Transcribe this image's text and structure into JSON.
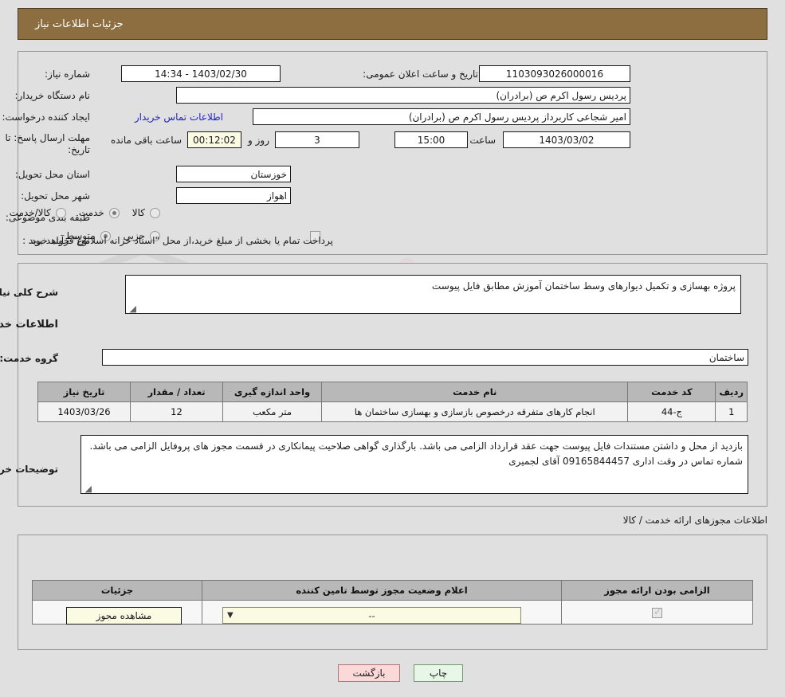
{
  "header": {
    "title": "جزئیات اطلاعات نیاز"
  },
  "watermark": {
    "text": "AriaTender.net"
  },
  "top_form": {
    "need_number_label": "شماره نیاز:",
    "need_number_value": "1103093026000016",
    "announce_datetime_label": "تاریخ و ساعت اعلان عمومی:",
    "announce_datetime_value": "1403/02/30 - 14:34",
    "buyer_org_label": "نام دستگاه خریدار:",
    "buyer_org_value": "پردیس رسول اکرم ص (برادران)",
    "creator_label": "ایجاد کننده درخواست:",
    "creator_value": "امیر  شجاعی کاربرداز پردیس رسول اکرم ص (برادران)",
    "contact_link": "اطلاعات تماس خریدار",
    "deadline_label_line1": "مهلت ارسال پاسخ: تا",
    "deadline_label_line2": "تاریخ:",
    "deadline_date_value": "1403/03/02",
    "deadline_hour_label": "ساعت",
    "deadline_hour_value": "15:00",
    "remaining_days_value": "3",
    "remaining_days_label": "روز و",
    "remaining_time_value": "00:12:02",
    "remaining_time_label": "ساعت باقی مانده",
    "province_label": "استان محل تحویل:",
    "province_value": "خوزستان",
    "city_label": "شهر محل تحویل:",
    "city_value": "اهواز",
    "category_label": "طبقه بندی موضوعی:",
    "category_options": [
      {
        "label": "کالا",
        "selected": false
      },
      {
        "label": "خدمت",
        "selected": true
      },
      {
        "label": "کالا/خدمت",
        "selected": false
      }
    ],
    "purchase_type_label": "نوع فرآیند خرید :",
    "purchase_type_options": [
      {
        "label": "جزیی",
        "selected": false
      },
      {
        "label": "متوسط",
        "selected": true
      }
    ],
    "treasury_checkbox_checked": false,
    "treasury_note": "پرداخت تمام یا بخشی از مبلغ خرید،از محل \"اسناد خزانه اسلامی\" خواهد بود."
  },
  "middle": {
    "need_desc_label": "شرح کلی نیاز:",
    "need_desc_value": "پروژه بهسازی و تکمیل دیوارهای وسط ساختمان آموزش مطابق فایل پیوست",
    "services_info_title": "اطلاعات خدمات مورد نیاز",
    "service_group_label": "گروه خدمت:",
    "service_group_value": "ساختمان",
    "table": {
      "columns": [
        "ردیف",
        "کد خدمت",
        "نام خدمت",
        "واحد اندازه گیری",
        "تعداد / مقدار",
        "تاریخ نیاز"
      ],
      "rows": [
        {
          "row": "1",
          "code": "ج-44",
          "name": "انجام کارهای متفرقه درخصوص بازسازی و بهسازی ساختمان ها",
          "unit": "متر مکعب",
          "qty": "12",
          "date": "1403/03/26"
        }
      ]
    },
    "buyer_notes_label": "توضیحات خریدار:",
    "buyer_notes_value": "بازدید از محل و داشتن مستندات فایل پیوست جهت عقد قرارداد الزامی می باشد. بارگذاری گواهی صلاحیت پیمانکاری در قسمت مجوز های پروفایل الزامی می باشد. شماره تماس در وقت اداری 09165844457 آقای لجمیری"
  },
  "licenses": {
    "section_title": "اطلاعات مجوزهای ارائه خدمت / کالا",
    "columns": [
      "الزامی بودن ارائه مجوز",
      "اعلام وضعیت مجوز توسط تامین کننده",
      "جزئیات"
    ],
    "rows": [
      {
        "required_checked": true,
        "status_value": "--",
        "details_button": "مشاهده مجوز"
      }
    ]
  },
  "footer": {
    "print_label": "چاپ",
    "back_label": "بازگشت"
  },
  "colors": {
    "header_bar": "#8d6e41",
    "page_bg": "#e0e0e0",
    "link": "#2222cc",
    "table_header": "#b8b8b8",
    "print_button": "#e7f6e7",
    "back_button": "#fcd9d9",
    "cream_field": "#fbfbe4"
  }
}
